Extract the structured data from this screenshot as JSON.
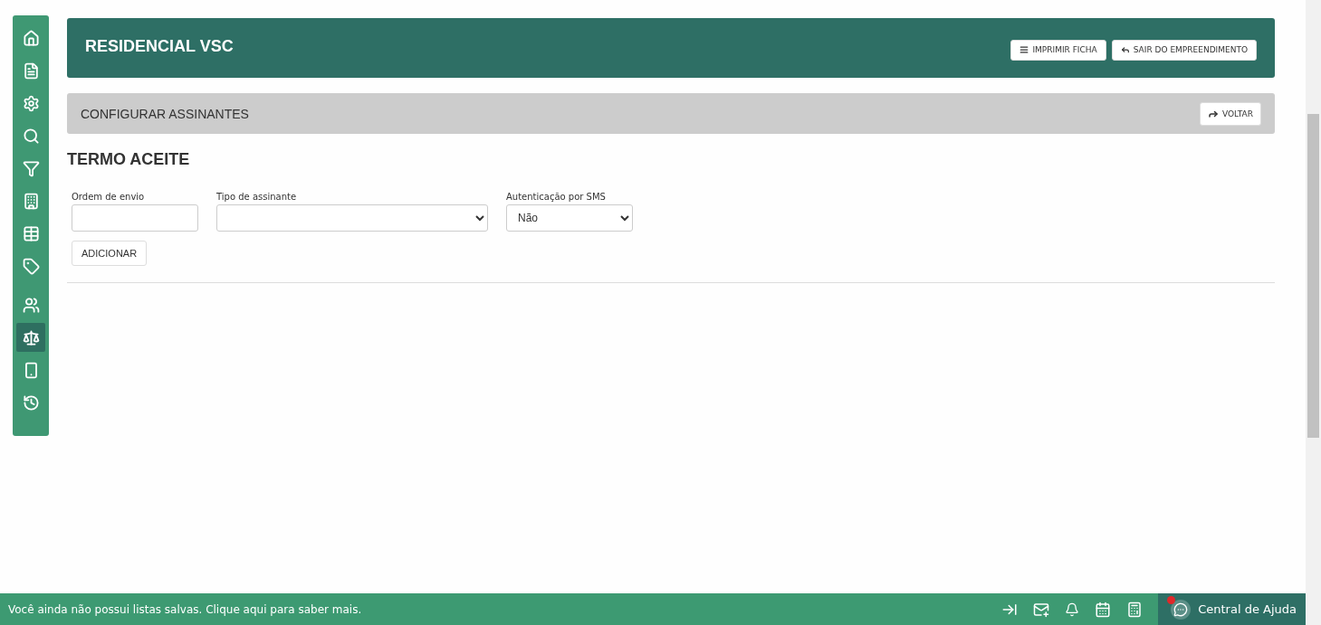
{
  "sidebar": {
    "items": [
      {
        "selected": false
      },
      {
        "selected": false
      },
      {
        "selected": false
      },
      {
        "selected": false
      },
      {
        "selected": false
      },
      {
        "selected": false
      },
      {
        "selected": false
      },
      {
        "selected": false
      },
      {
        "selected": false
      },
      {
        "selected": true
      },
      {
        "selected": false
      },
      {
        "selected": false
      }
    ]
  },
  "header": {
    "title": "RESIDENCIAL VSC",
    "buttons": [
      "IMPRIMIR FICHA",
      "SAIR DO EMPREENDIMENTO"
    ]
  },
  "subheader": {
    "title": "CONFIGURAR ASSINANTES",
    "button": "VOLTAR"
  },
  "section": {
    "title": "TERMO ACEITE"
  },
  "form": {
    "fields": [
      {
        "kind": "input",
        "label": "Ordem de envio"
      },
      {
        "kind": "select",
        "label": "Tipo de assinante"
      },
      {
        "kind": "select",
        "label": "Autenticação por SMS",
        "value": "Não"
      }
    ],
    "button": "ADICIONAR"
  },
  "footer": {
    "message": "Você ainda não possui listas salvas. Clique aqui para saber mais.",
    "help": "Central de Ajuda"
  }
}
